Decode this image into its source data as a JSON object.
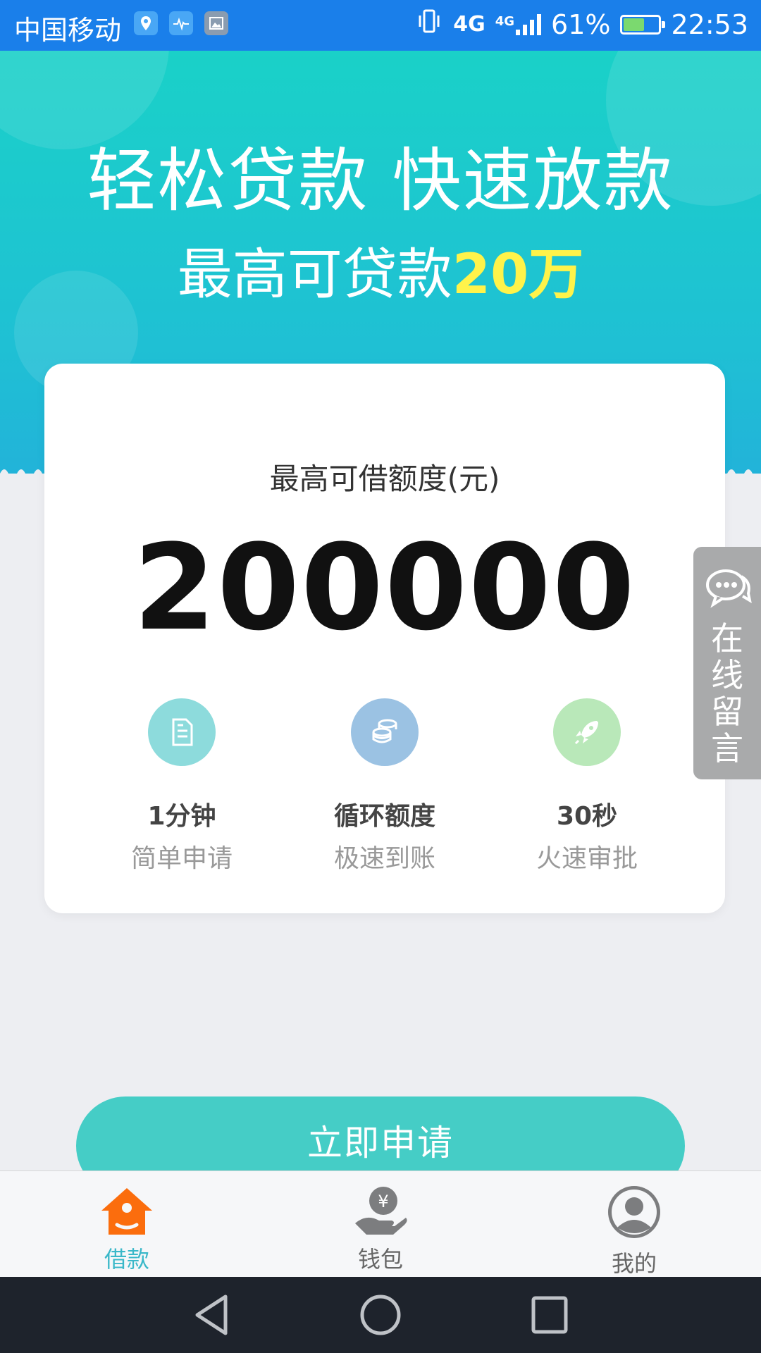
{
  "status_bar": {
    "carrier": "中国移动",
    "network_primary": "4G",
    "network_secondary": "4G",
    "battery_percent_text": "61%",
    "battery_level": 0.61,
    "time": "22:53",
    "icons": [
      "location-icon",
      "heartbeat-icon",
      "gallery-icon",
      "vibrate-icon",
      "signal-icon",
      "battery-icon"
    ]
  },
  "hero": {
    "title": "轻松贷款 快速放款",
    "subtitle_prefix": "最高可贷款",
    "subtitle_highlight": "20万",
    "highlight_color": "#fff34a"
  },
  "card": {
    "label": "最高可借额度(元)",
    "amount": "200000",
    "features": [
      {
        "icon": "document-icon",
        "color": "#8ddbdc",
        "main": "1分钟",
        "sub": "简单申请"
      },
      {
        "icon": "coins-icon",
        "color": "#9bc2e3",
        "main": "循环额度",
        "sub": "极速到账"
      },
      {
        "icon": "rocket-icon",
        "color": "#b9e8b9",
        "main": "30秒",
        "sub": "火速审批"
      }
    ]
  },
  "side_tab": {
    "icon": "chat-icon",
    "label": "在线留言"
  },
  "apply_button": {
    "label": "立即申请",
    "color": "#45cdc6"
  },
  "bottom_nav": {
    "items": [
      {
        "icon": "home-icon",
        "label": "借款",
        "active": true
      },
      {
        "icon": "wallet-icon",
        "label": "钱包",
        "active": false
      },
      {
        "icon": "profile-icon",
        "label": "我的",
        "active": false
      }
    ],
    "active_color": "#3ab8c9"
  },
  "system_nav": {
    "buttons": [
      "back-icon",
      "home-circle-icon",
      "recents-icon"
    ]
  }
}
